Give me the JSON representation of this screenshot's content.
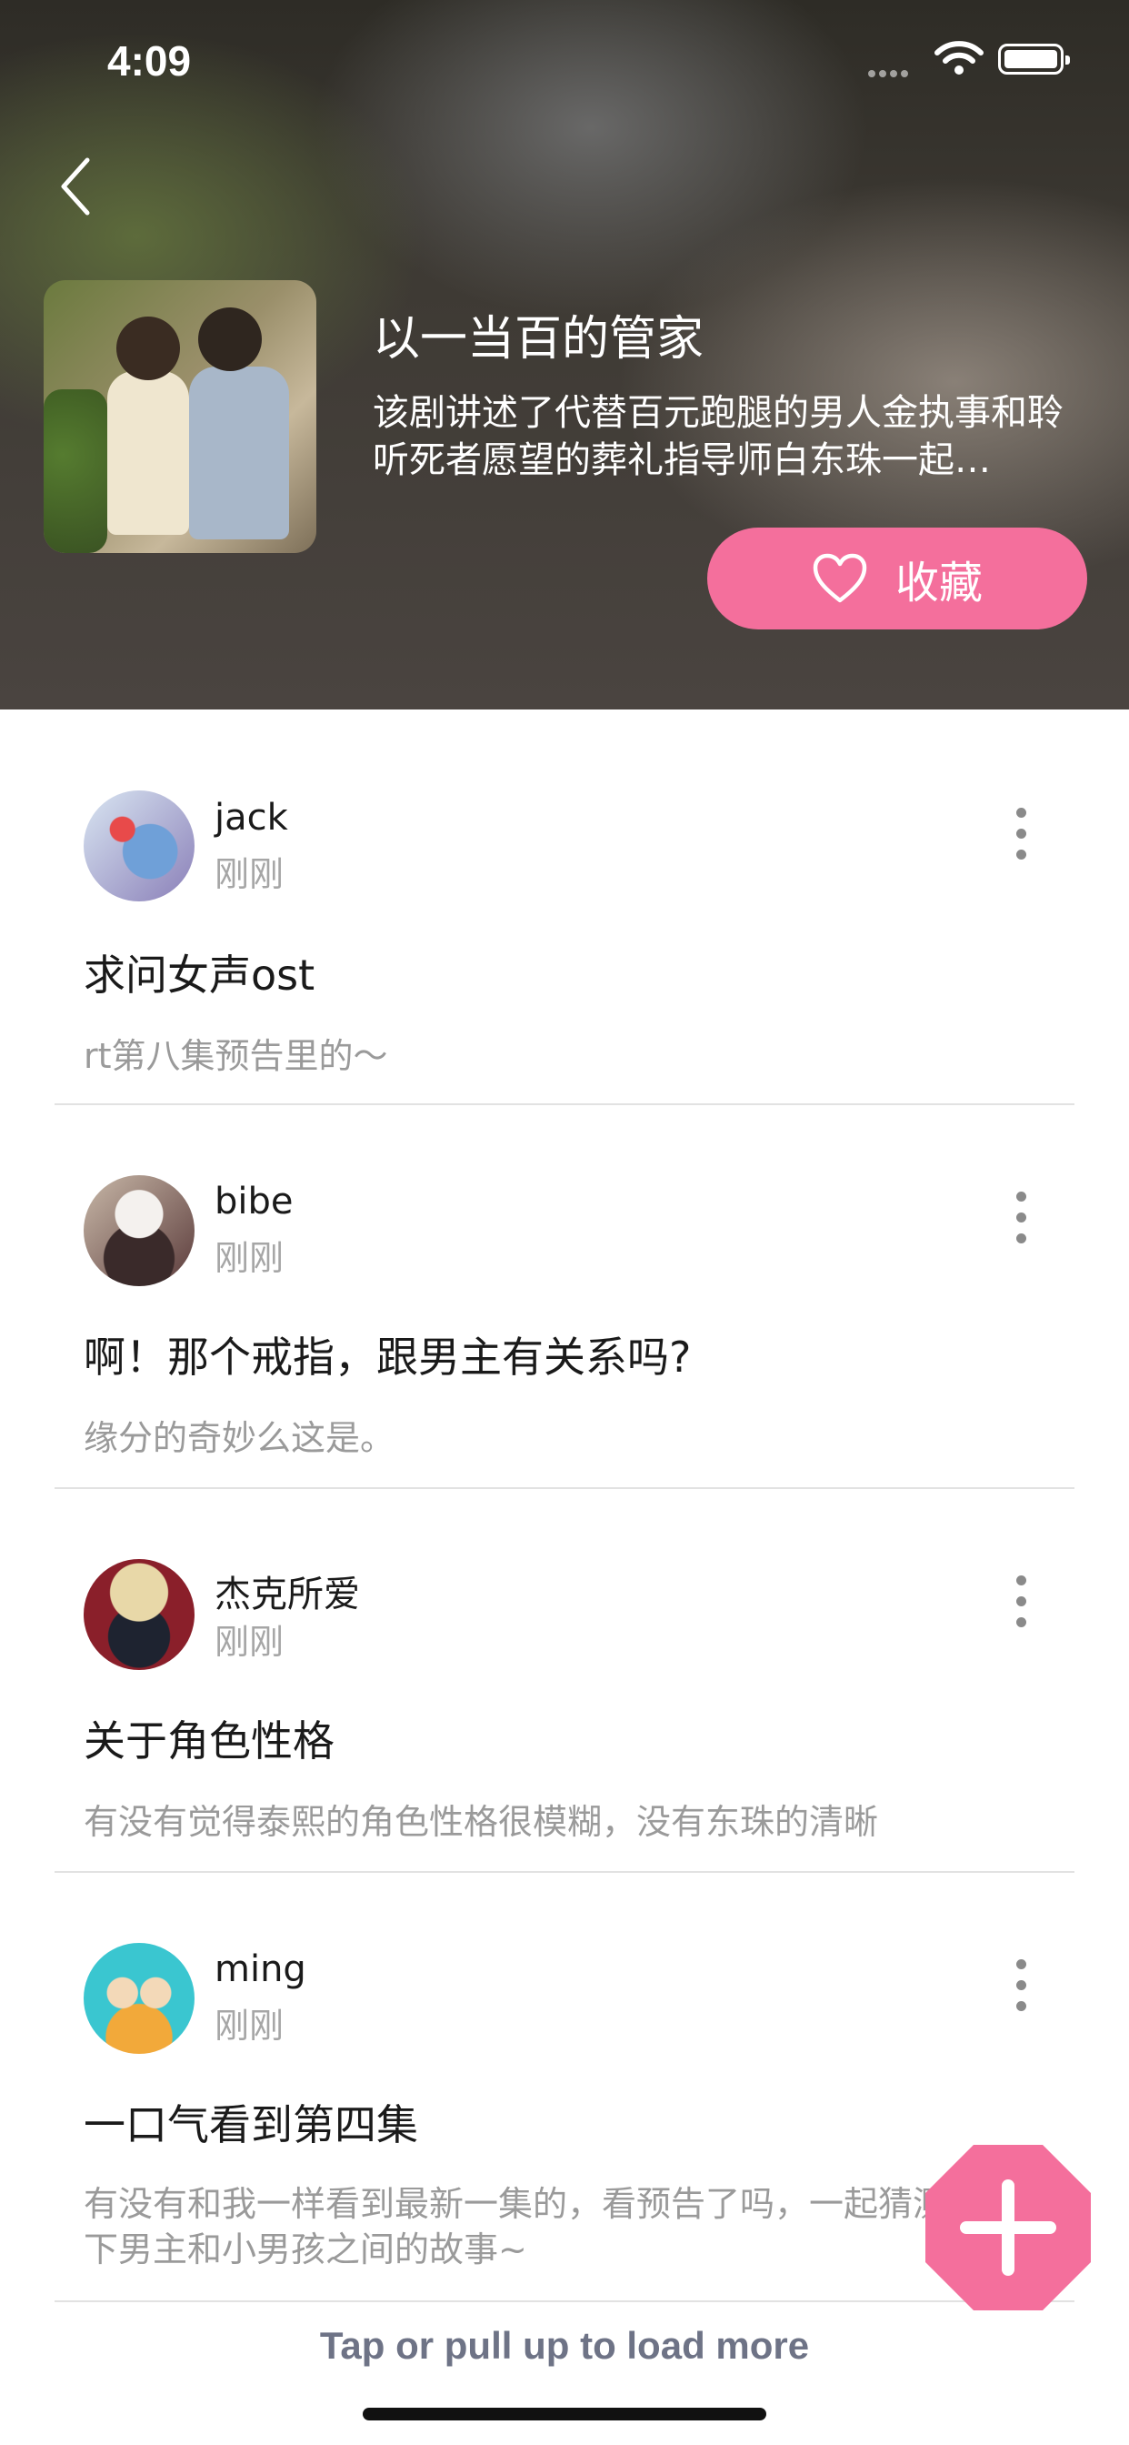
{
  "status_bar": {
    "time": "4:09"
  },
  "drama": {
    "title": "以一当百的管家",
    "description": "该剧讲述了代替百元跑腿的男人金执事和聆听死者愿望的葬礼指导师白东珠一起…",
    "favorite_label": "收藏"
  },
  "posts": [
    {
      "username": "jack",
      "time": "刚刚",
      "title": "求问女声ost",
      "body": "rt第八集预告里的～"
    },
    {
      "username": "bibe",
      "time": "刚刚",
      "title": "啊！那个戒指，跟男主有关系吗?",
      "body": "缘分的奇妙么这是。"
    },
    {
      "username": "杰克所爱",
      "time": "刚刚",
      "title": "关于角色性格",
      "body": "有没有觉得泰熙的角色性格很模糊，没有东珠的清晰"
    },
    {
      "username": "ming",
      "time": "刚刚",
      "title": "一口气看到第四集",
      "body": "有没有和我一样看到最新一集的，看预告了吗，一起猜测一下男主和小男孩之间的故事~"
    }
  ],
  "footer": {
    "load_more": "Tap or pull up to load more"
  },
  "colors": {
    "accent": "#f46f9c",
    "muted_text": "#9a9a9a",
    "load_more": "#6e7386"
  },
  "icons": [
    "back-icon",
    "heart-icon",
    "more-vertical-icon",
    "plus-icon",
    "wifi-icon",
    "battery-icon"
  ]
}
